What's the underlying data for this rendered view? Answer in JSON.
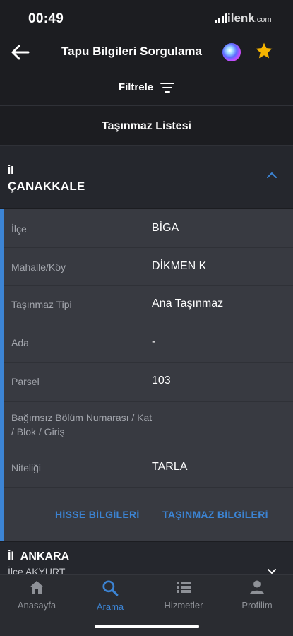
{
  "status_bar": {
    "time": "00:49",
    "watermark_main": "ilenk",
    "watermark_suffix": ".com"
  },
  "header": {
    "title": "Tapu Bilgileri Sorgulama"
  },
  "filter": {
    "label": "Filtrele"
  },
  "list": {
    "title": "Taşınmaz Listesi"
  },
  "card": {
    "il_label": "İl",
    "city": "ÇANAKKALE",
    "rows": [
      {
        "label": "İlçe",
        "value": "BİGA"
      },
      {
        "label": "Mahalle/Köy",
        "value": "DİKMEN K"
      },
      {
        "label": "Taşınmaz Tipi",
        "value": "Ana Taşınmaz"
      },
      {
        "label": "Ada",
        "value": "-"
      },
      {
        "label": "Parsel",
        "value": "103"
      },
      {
        "label": "Bağımsız Bölüm Numarası / Kat / Blok / Giriş",
        "value": ""
      },
      {
        "label": "Niteliği",
        "value": "TARLA"
      }
    ],
    "actions": {
      "share_info": "HİSSE BİLGİLERİ",
      "property_info": "TAŞINMAZ BİLGİLERİ"
    }
  },
  "card2": {
    "il_label": "İl",
    "city": "ANKARA",
    "subtitle": "İlçe  AKYURT"
  },
  "tabs": [
    {
      "label": "Anasayfa",
      "icon": "home-icon",
      "active": false
    },
    {
      "label": "Arama",
      "icon": "search-icon",
      "active": true
    },
    {
      "label": "Hizmetler",
      "icon": "list-icon",
      "active": false
    },
    {
      "label": "Profilim",
      "icon": "user-icon",
      "active": false
    }
  ],
  "colors": {
    "background": "#1c1d21",
    "panel": "#383a41",
    "accent": "#3c84d4",
    "star": "#f5b400"
  }
}
